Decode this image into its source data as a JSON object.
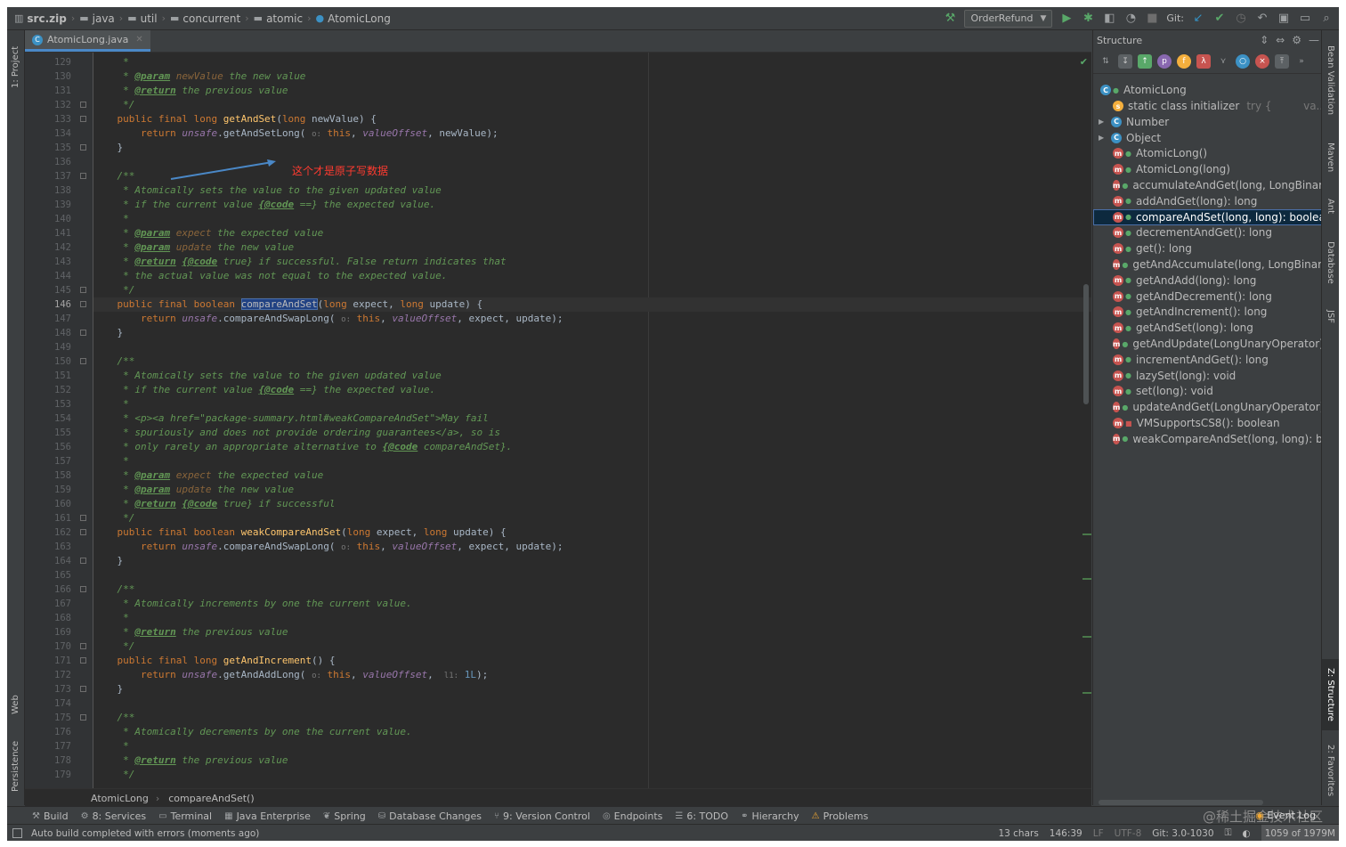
{
  "breadcrumbs": [
    "src.zip",
    "java",
    "util",
    "concurrent",
    "atomic",
    "AtomicLong"
  ],
  "toolbar": {
    "run_config": "OrderRefund",
    "git_label": "Git:"
  },
  "left_tabs": [
    "1: Project",
    "Web",
    "Persistence"
  ],
  "right_tabs": [
    "Bean Validation",
    "Maven",
    "Ant",
    "Database",
    "JSF",
    "Z: Structure",
    "2: Favorites"
  ],
  "editor": {
    "tab_title": "AtomicLong.java",
    "annotation": "这个才是原子写数据",
    "current_line": "146",
    "lines": [
      {
        "n": "129",
        "parts": [
          [
            "c",
            "     *"
          ]
        ]
      },
      {
        "n": "130",
        "parts": [
          [
            "c",
            "     * "
          ],
          [
            "tag",
            "@param"
          ],
          [
            "pv",
            " newValue"
          ],
          [
            "c",
            " the new value"
          ]
        ]
      },
      {
        "n": "131",
        "parts": [
          [
            "c",
            "     * "
          ],
          [
            "tag",
            "@return"
          ],
          [
            "c",
            " the previous value"
          ]
        ]
      },
      {
        "n": "132",
        "parts": [
          [
            "c",
            "     */"
          ]
        ]
      },
      {
        "n": "133",
        "parts": [
          [
            "k",
            "    public final long "
          ],
          [
            "m",
            "getAndSet"
          ],
          [
            "plain",
            "("
          ],
          [
            "k",
            "long"
          ],
          [
            "plain",
            " newValue) {"
          ]
        ]
      },
      {
        "n": "134",
        "parts": [
          [
            "k",
            "        return "
          ],
          [
            "f",
            "unsafe"
          ],
          [
            "plain",
            ".getAndSetLong( "
          ],
          [
            "hint",
            "o:"
          ],
          [
            "k",
            " this"
          ],
          [
            "plain",
            ", "
          ],
          [
            "f",
            "valueOffset"
          ],
          [
            "plain",
            ", newValue);"
          ]
        ]
      },
      {
        "n": "135",
        "parts": [
          [
            "plain",
            "    }"
          ]
        ]
      },
      {
        "n": "136",
        "parts": [
          [
            "plain",
            ""
          ]
        ]
      },
      {
        "n": "137",
        "parts": [
          [
            "c",
            "    /**"
          ]
        ]
      },
      {
        "n": "138",
        "parts": [
          [
            "c",
            "     * Atomically sets the value to the given updated value"
          ]
        ]
      },
      {
        "n": "139",
        "parts": [
          [
            "c",
            "     * if the current value "
          ],
          [
            "tag",
            "{@code"
          ],
          [
            "c",
            " ==}"
          ],
          [
            "c",
            " the expected value."
          ]
        ]
      },
      {
        "n": "140",
        "parts": [
          [
            "c",
            "     *"
          ]
        ]
      },
      {
        "n": "141",
        "parts": [
          [
            "c",
            "     * "
          ],
          [
            "tag",
            "@param"
          ],
          [
            "pv",
            " expect"
          ],
          [
            "c",
            " the expected value"
          ]
        ]
      },
      {
        "n": "142",
        "parts": [
          [
            "c",
            "     * "
          ],
          [
            "tag",
            "@param"
          ],
          [
            "pv",
            " update"
          ],
          [
            "c",
            " the new value"
          ]
        ]
      },
      {
        "n": "143",
        "parts": [
          [
            "c",
            "     * "
          ],
          [
            "tag",
            "@return"
          ],
          [
            "c",
            " "
          ],
          [
            "tag",
            "{@code"
          ],
          [
            "c",
            " true} if successful. False return indicates that"
          ]
        ]
      },
      {
        "n": "144",
        "parts": [
          [
            "c",
            "     * the actual value was not equal to the expected value."
          ]
        ]
      },
      {
        "n": "145",
        "parts": [
          [
            "c",
            "     */"
          ]
        ]
      },
      {
        "n": "146",
        "parts": [
          [
            "k",
            "    public final boolean "
          ],
          [
            "sel",
            "compareAndSet"
          ],
          [
            "plain",
            "("
          ],
          [
            "k",
            "long"
          ],
          [
            "plain",
            " expect, "
          ],
          [
            "k",
            "long"
          ],
          [
            "plain",
            " update) {"
          ]
        ]
      },
      {
        "n": "147",
        "parts": [
          [
            "k",
            "        return "
          ],
          [
            "f",
            "unsafe"
          ],
          [
            "plain",
            ".compareAndSwapLong( "
          ],
          [
            "hint",
            "o:"
          ],
          [
            "k",
            " this"
          ],
          [
            "plain",
            ", "
          ],
          [
            "f",
            "valueOffset"
          ],
          [
            "plain",
            ", expect, update);"
          ]
        ]
      },
      {
        "n": "148",
        "parts": [
          [
            "plain",
            "    }"
          ]
        ]
      },
      {
        "n": "149",
        "parts": [
          [
            "plain",
            ""
          ]
        ]
      },
      {
        "n": "150",
        "parts": [
          [
            "c",
            "    /**"
          ]
        ]
      },
      {
        "n": "151",
        "parts": [
          [
            "c",
            "     * Atomically sets the value to the given updated value"
          ]
        ]
      },
      {
        "n": "152",
        "parts": [
          [
            "c",
            "     * if the current value "
          ],
          [
            "tag",
            "{@code"
          ],
          [
            "c",
            " ==}"
          ],
          [
            "c",
            " the expected value."
          ]
        ]
      },
      {
        "n": "153",
        "parts": [
          [
            "c",
            "     *"
          ]
        ]
      },
      {
        "n": "154",
        "parts": [
          [
            "c",
            "     * <p><a href=\"package-summary.html#weakCompareAndSet\">May fail"
          ]
        ]
      },
      {
        "n": "155",
        "parts": [
          [
            "c",
            "     * spuriously and does not provide ordering guarantees</a>, so is"
          ]
        ]
      },
      {
        "n": "156",
        "parts": [
          [
            "c",
            "     * only rarely an appropriate alternative to "
          ],
          [
            "tag",
            "{@code"
          ],
          [
            "c",
            " compareAndSet}."
          ]
        ]
      },
      {
        "n": "157",
        "parts": [
          [
            "c",
            "     *"
          ]
        ]
      },
      {
        "n": "158",
        "parts": [
          [
            "c",
            "     * "
          ],
          [
            "tag",
            "@param"
          ],
          [
            "pv",
            " expect"
          ],
          [
            "c",
            " the expected value"
          ]
        ]
      },
      {
        "n": "159",
        "parts": [
          [
            "c",
            "     * "
          ],
          [
            "tag",
            "@param"
          ],
          [
            "pv",
            " update"
          ],
          [
            "c",
            " the new value"
          ]
        ]
      },
      {
        "n": "160",
        "parts": [
          [
            "c",
            "     * "
          ],
          [
            "tag",
            "@return"
          ],
          [
            "c",
            " "
          ],
          [
            "tag",
            "{@code"
          ],
          [
            "c",
            " true} if successful"
          ]
        ]
      },
      {
        "n": "161",
        "parts": [
          [
            "c",
            "     */"
          ]
        ]
      },
      {
        "n": "162",
        "parts": [
          [
            "k",
            "    public final boolean "
          ],
          [
            "m",
            "weakCompareAndSet"
          ],
          [
            "plain",
            "("
          ],
          [
            "k",
            "long"
          ],
          [
            "plain",
            " expect, "
          ],
          [
            "k",
            "long"
          ],
          [
            "plain",
            " update) {"
          ]
        ]
      },
      {
        "n": "163",
        "parts": [
          [
            "k",
            "        return "
          ],
          [
            "f",
            "unsafe"
          ],
          [
            "plain",
            ".compareAndSwapLong( "
          ],
          [
            "hint",
            "o:"
          ],
          [
            "k",
            " this"
          ],
          [
            "plain",
            ", "
          ],
          [
            "f",
            "valueOffset"
          ],
          [
            "plain",
            ", expect, update);"
          ]
        ]
      },
      {
        "n": "164",
        "parts": [
          [
            "plain",
            "    }"
          ]
        ]
      },
      {
        "n": "165",
        "parts": [
          [
            "plain",
            ""
          ]
        ]
      },
      {
        "n": "166",
        "parts": [
          [
            "c",
            "    /**"
          ]
        ]
      },
      {
        "n": "167",
        "parts": [
          [
            "c",
            "     * Atomically increments by one the current value."
          ]
        ]
      },
      {
        "n": "168",
        "parts": [
          [
            "c",
            "     *"
          ]
        ]
      },
      {
        "n": "169",
        "parts": [
          [
            "c",
            "     * "
          ],
          [
            "tag",
            "@return"
          ],
          [
            "c",
            " the previous value"
          ]
        ]
      },
      {
        "n": "170",
        "parts": [
          [
            "c",
            "     */"
          ]
        ]
      },
      {
        "n": "171",
        "parts": [
          [
            "k",
            "    public final long "
          ],
          [
            "m",
            "getAndIncrement"
          ],
          [
            "plain",
            "() {"
          ]
        ]
      },
      {
        "n": "172",
        "parts": [
          [
            "k",
            "        return "
          ],
          [
            "f",
            "unsafe"
          ],
          [
            "plain",
            ".getAndAddLong( "
          ],
          [
            "hint",
            "o:"
          ],
          [
            "k",
            " this"
          ],
          [
            "plain",
            ", "
          ],
          [
            "f",
            "valueOffset"
          ],
          [
            "plain",
            ", "
          ],
          [
            "hint",
            " l1:"
          ],
          [
            "n",
            " 1L"
          ],
          [
            "plain",
            ");"
          ]
        ]
      },
      {
        "n": "173",
        "parts": [
          [
            "plain",
            "    }"
          ]
        ]
      },
      {
        "n": "174",
        "parts": [
          [
            "plain",
            ""
          ]
        ]
      },
      {
        "n": "175",
        "parts": [
          [
            "c",
            "    /**"
          ]
        ]
      },
      {
        "n": "176",
        "parts": [
          [
            "c",
            "     * Atomically decrements by one the current value."
          ]
        ]
      },
      {
        "n": "177",
        "parts": [
          [
            "c",
            "     *"
          ]
        ]
      },
      {
        "n": "178",
        "parts": [
          [
            "c",
            "     * "
          ],
          [
            "tag",
            "@return"
          ],
          [
            "c",
            " the previous value"
          ]
        ]
      },
      {
        "n": "179",
        "parts": [
          [
            "c",
            "     */"
          ]
        ]
      }
    ],
    "breadcrumb": [
      "AtomicLong",
      "compareAndSet()"
    ]
  },
  "structure": {
    "title": "Structure",
    "root": "AtomicLong",
    "items": [
      {
        "label": "static class initializer",
        "suffix": "try {",
        "suffix2": "va...",
        "icon": "init",
        "indent": 1
      },
      {
        "label": "Number",
        "icon": "class",
        "indent": 0,
        "arrow": true
      },
      {
        "label": "Object",
        "icon": "class",
        "indent": 0,
        "arrow": true
      },
      {
        "label": "AtomicLong()",
        "icon": "method",
        "indent": 1
      },
      {
        "label": "AtomicLong(long)",
        "icon": "method",
        "indent": 1
      },
      {
        "label": "accumulateAndGet(long, LongBinaryOperator): long",
        "icon": "method",
        "indent": 1
      },
      {
        "label": "addAndGet(long): long",
        "icon": "method",
        "indent": 1
      },
      {
        "label": "compareAndSet(long, long): boolean",
        "icon": "method",
        "indent": 1,
        "selected": true
      },
      {
        "label": "decrementAndGet(): long",
        "icon": "method",
        "indent": 1
      },
      {
        "label": "get(): long",
        "icon": "method",
        "indent": 1
      },
      {
        "label": "getAndAccumulate(long, LongBinaryOperator): long",
        "icon": "method",
        "indent": 1
      },
      {
        "label": "getAndAdd(long): long",
        "icon": "method",
        "indent": 1
      },
      {
        "label": "getAndDecrement(): long",
        "icon": "method",
        "indent": 1
      },
      {
        "label": "getAndIncrement(): long",
        "icon": "method",
        "indent": 1
      },
      {
        "label": "getAndSet(long): long",
        "icon": "method",
        "indent": 1
      },
      {
        "label": "getAndUpdate(LongUnaryOperator): long",
        "icon": "method",
        "indent": 1
      },
      {
        "label": "incrementAndGet(): long",
        "icon": "method",
        "indent": 1
      },
      {
        "label": "lazySet(long): void",
        "icon": "method",
        "indent": 1
      },
      {
        "label": "set(long): void",
        "icon": "method",
        "indent": 1
      },
      {
        "label": "updateAndGet(LongUnaryOperator): long",
        "icon": "method",
        "indent": 1
      },
      {
        "label": "VMSupportsCS8(): boolean",
        "icon": "method",
        "indent": 1,
        "private": true
      },
      {
        "label": "weakCompareAndSet(long, long): boolean",
        "icon": "method",
        "indent": 1
      }
    ]
  },
  "tool_windows": [
    {
      "label": "Build",
      "icon": "hammer"
    },
    {
      "label": "8: Services",
      "icon": "services"
    },
    {
      "label": "Terminal",
      "icon": "terminal"
    },
    {
      "label": "Java Enterprise",
      "icon": "enterprise"
    },
    {
      "label": "Spring",
      "icon": "spring"
    },
    {
      "label": "Database Changes",
      "icon": "database"
    },
    {
      "label": "9: Version Control",
      "icon": "vcs"
    },
    {
      "label": "Endpoints",
      "icon": "endpoints"
    },
    {
      "label": "6: TODO",
      "icon": "todo"
    },
    {
      "label": "Hierarchy",
      "icon": "hierarchy"
    },
    {
      "label": "Problems",
      "icon": "warning"
    }
  ],
  "event_log": "Event Log",
  "watermark": "@稀土掘金技术社区",
  "status": {
    "message": "Auto build completed with errors (moments ago)",
    "chars": "13 chars",
    "position": "146:39",
    "line_sep": "LF",
    "encoding": "UTF-8",
    "git": "Git: 3.0-1030",
    "memory": "1059 of 1979M"
  }
}
